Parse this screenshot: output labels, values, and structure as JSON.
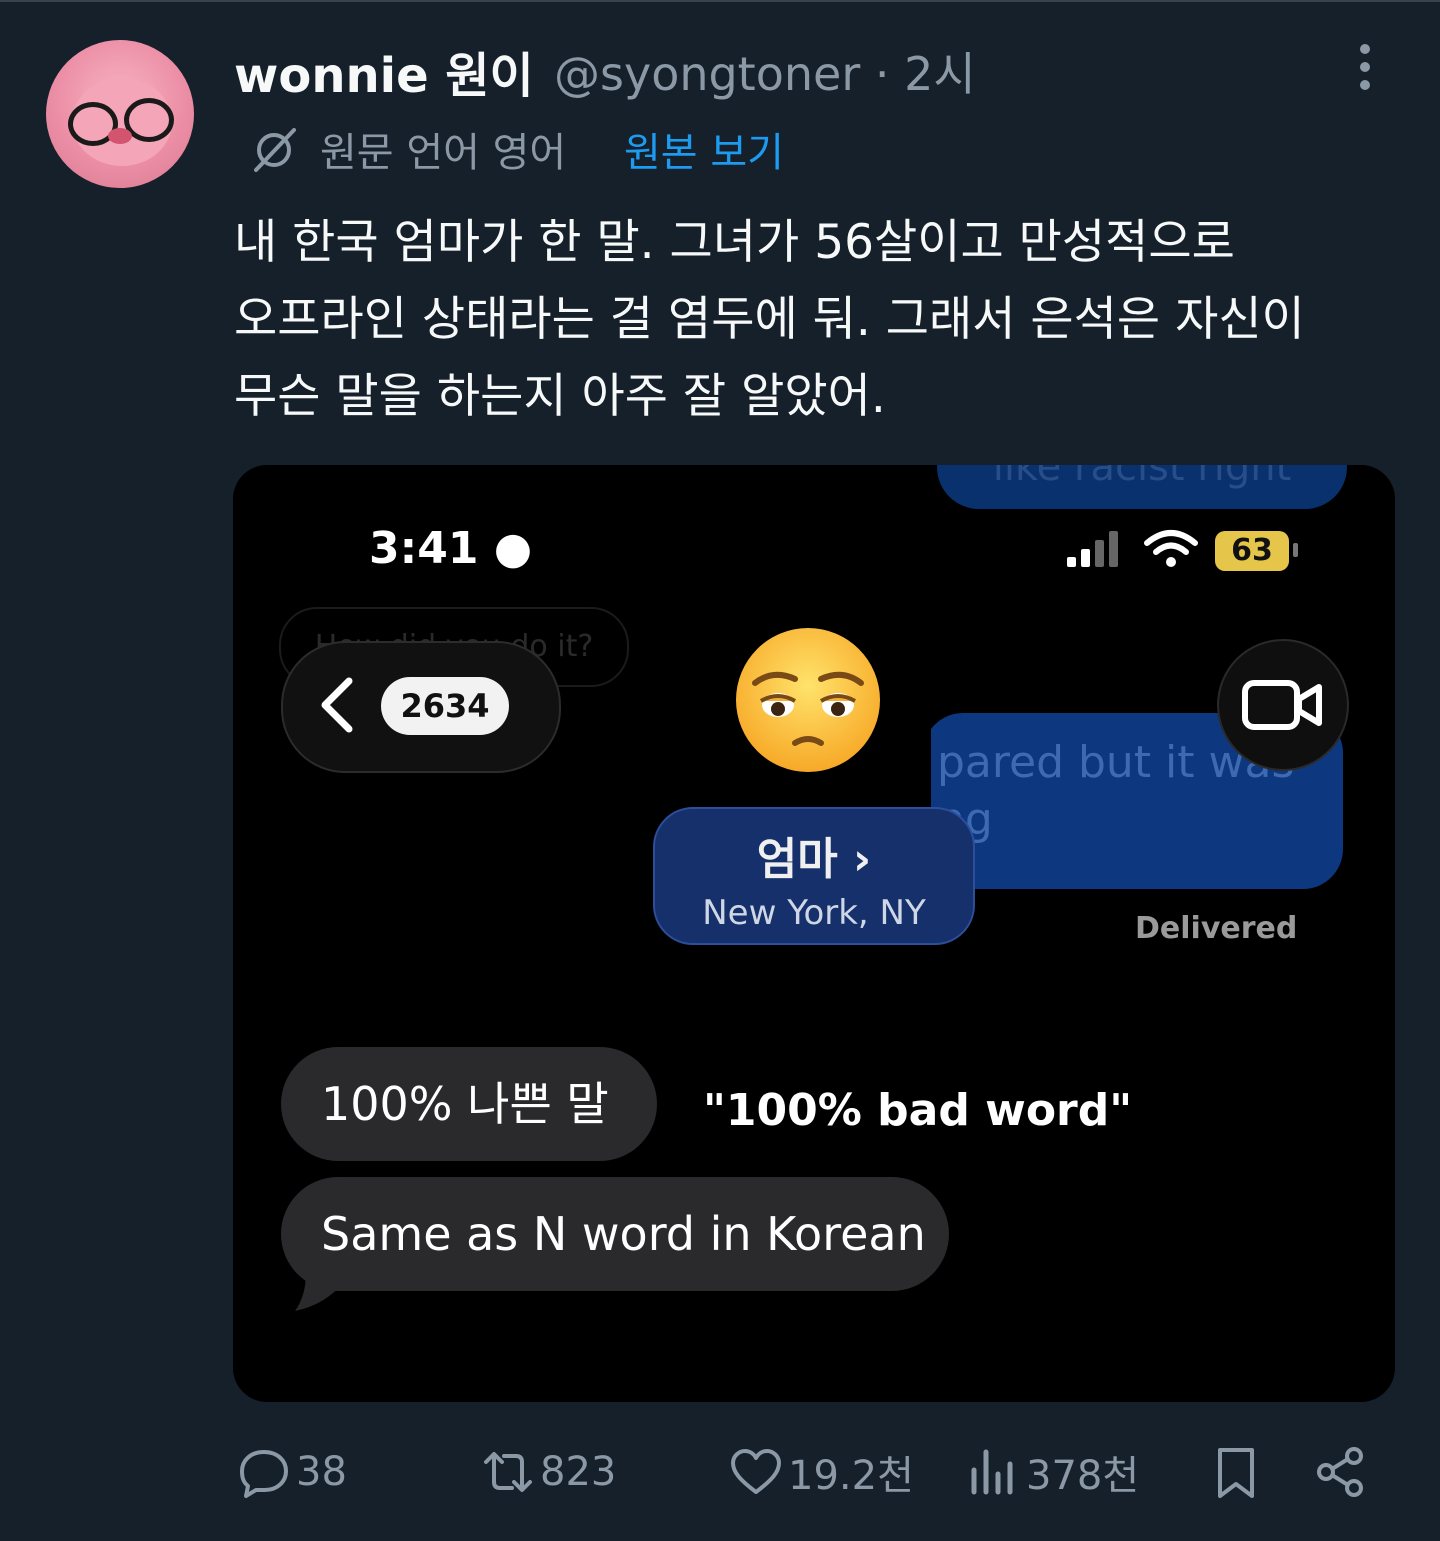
{
  "author": {
    "name": "wonnie 원이",
    "handle": "@syongtoner",
    "separator": "·",
    "time": "2시"
  },
  "translation": {
    "label": "원문 언어 영어",
    "link": "원본 보기"
  },
  "tweet_lines": [
    "내 한국 엄마가 한 말. 그녀가 56살이고 만성적으로",
    "오프라인 상태라는 걸 염두에 둬. 그래서 은석은 자신이",
    "무슨 말을 하는지 아주 잘 알았어."
  ],
  "media": {
    "status_time": "3:41",
    "battery": "63",
    "ghost_top": "like racist right",
    "ghost_mid": "How did you do it?",
    "ghost_blue_1": "pared but it was",
    "ghost_blue_2": "ng",
    "back_badge": "2634",
    "contact_name": "엄마 ›",
    "contact_location": "New York, NY",
    "delivered": "Delivered",
    "bubble_1": "100% 나쁜 말",
    "quote": "\"100% bad word\"",
    "bubble_2": "Same as N word in Korean"
  },
  "actions": {
    "replies": "38",
    "reposts": "823",
    "likes": "19.2천",
    "views": "378천"
  },
  "icons": {
    "more": "more-icon",
    "translate": "translate-icon",
    "reply": "reply-icon",
    "repost": "repost-icon",
    "like": "heart-icon",
    "views": "views-icon",
    "bookmark": "bookmark-icon",
    "share": "share-icon"
  },
  "colors": {
    "background": "#15202b",
    "link": "#1d9bf0",
    "muted": "#8b98a5",
    "text": "#f7f9f9"
  }
}
